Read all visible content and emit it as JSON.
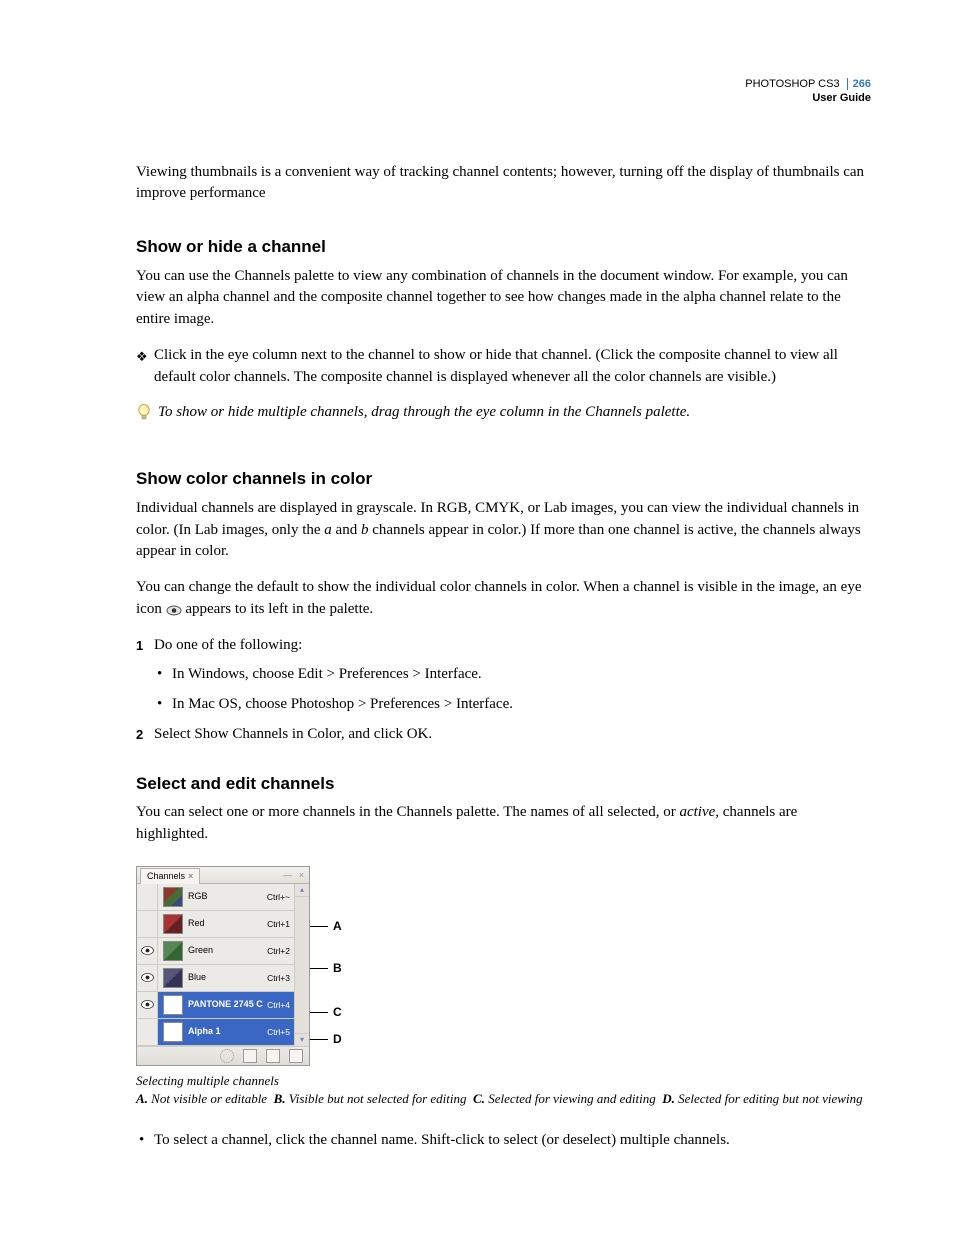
{
  "header": {
    "product": "PHOTOSHOP CS3",
    "guide": "User Guide",
    "page": "266"
  },
  "intro": "Viewing thumbnails is a convenient way of tracking channel contents; however, turning off the display of thumbnails can improve performance",
  "s1": {
    "title": "Show or hide a channel",
    "p1": "You can use the Channels palette to view any combination of channels in the document window. For example, you can view an alpha channel and the composite channel together to see how changes made in the alpha channel relate to the entire image.",
    "p2": "Click in the eye column next to the channel to show or hide that channel. (Click the composite channel to view all default color channels. The composite channel is displayed whenever all the color channels are visible.)",
    "tip": "To show or hide multiple channels, drag through the eye column in the Channels palette."
  },
  "s2": {
    "title": "Show color channels in color",
    "p1a": "Individual channels are displayed in grayscale. In RGB, CMYK, or Lab images, you can view the individual channels in color. (In Lab images, only the ",
    "p1i1": "a",
    "p1b": " and ",
    "p1i2": "b",
    "p1c": " channels appear in color.) If more than one channel is active, the channels always appear in color.",
    "p2a": "You can change the default to show the individual color channels in color. When a channel is visible in the image, an eye icon ",
    "p2b": " appears to its left in the palette.",
    "step1": "Do one of the following:",
    "sub1": "In Windows, choose Edit > Preferences > Interface.",
    "sub2": "In Mac OS, choose Photoshop > Preferences > Interface.",
    "step2": "Select Show Channels in Color, and click OK."
  },
  "s3": {
    "title": "Select and edit channels",
    "p1a": "You can select one or more channels in the Channels palette. The names of all selected, or ",
    "p1i": "active",
    "p1b": ", channels are highlighted.",
    "bullet": "To select a channel, click the channel name. Shift-click to select (or deselect) multiple channels."
  },
  "palette": {
    "tab": "Channels",
    "rows": [
      {
        "name": "RGB",
        "short": "Ctrl+~",
        "eye": false,
        "sel": false,
        "th": "th-rgb"
      },
      {
        "name": "Red",
        "short": "Ctrl+1",
        "eye": false,
        "sel": false,
        "th": "th-red"
      },
      {
        "name": "Green",
        "short": "Ctrl+2",
        "eye": true,
        "sel": false,
        "th": "th-green"
      },
      {
        "name": "Blue",
        "short": "Ctrl+3",
        "eye": true,
        "sel": false,
        "th": "th-blue"
      },
      {
        "name": "PANTONE 2745 C",
        "short": "Ctrl+4",
        "eye": true,
        "sel": true,
        "th": "th-white",
        "bold": true
      },
      {
        "name": "Alpha 1",
        "short": "Ctrl+5",
        "eye": false,
        "sel": true,
        "th": "th-white",
        "bold": true
      }
    ],
    "callouts": {
      "A": "A",
      "B": "B",
      "C": "C",
      "D": "D"
    }
  },
  "caption": {
    "title": "Selecting multiple channels",
    "A": "Not visible or editable",
    "B": "Visible but not selected for editing",
    "C": "Selected for viewing and editing",
    "D": "Selected for editing but not viewing",
    "labA": "A.",
    "labB": "B.",
    "labC": "C.",
    "labD": "D."
  }
}
